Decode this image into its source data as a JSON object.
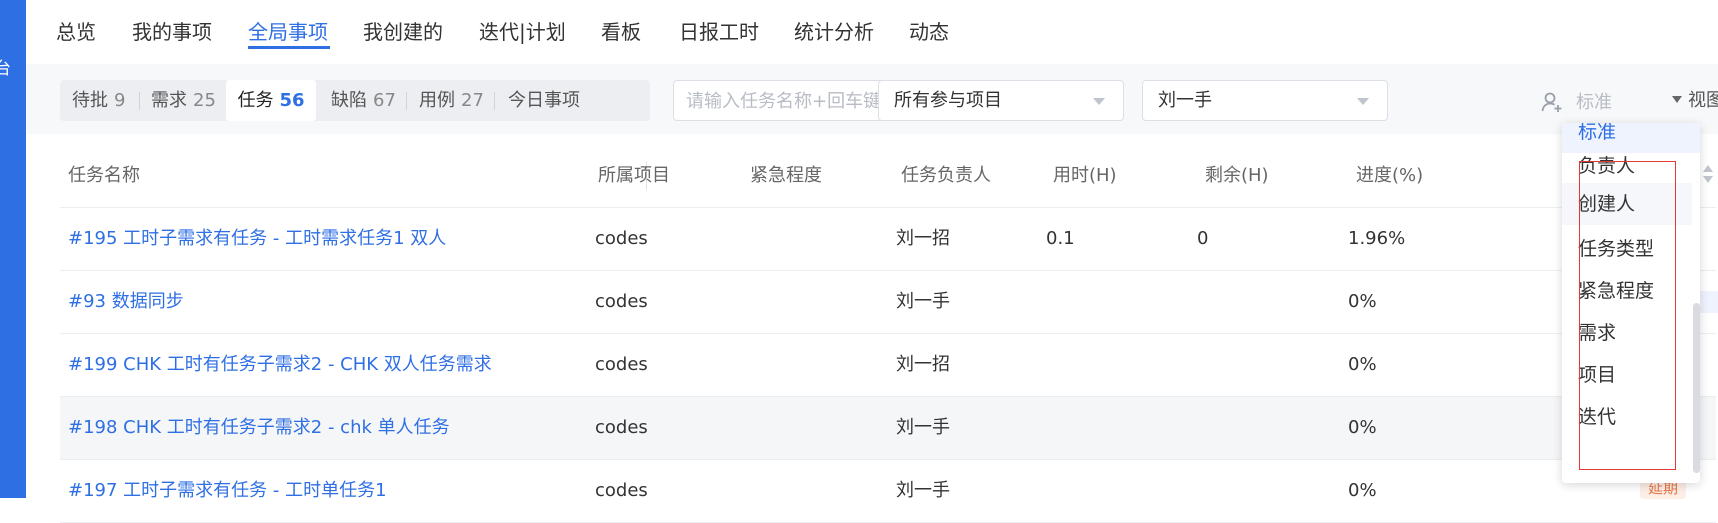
{
  "sidebar": {
    "fragment": "台"
  },
  "nav": {
    "tabs": [
      {
        "label": "总览"
      },
      {
        "label": "我的事项"
      },
      {
        "label": "全局事项"
      },
      {
        "label": "我创建的"
      },
      {
        "label": "迭代|计划"
      },
      {
        "label": "看板"
      },
      {
        "label": "日报工时"
      },
      {
        "label": "统计分析"
      },
      {
        "label": "动态"
      }
    ],
    "active": "全局事项"
  },
  "segments": [
    {
      "label": "待批",
      "count": "9"
    },
    {
      "label": "需求",
      "count": "25"
    },
    {
      "label": "任务",
      "count": "56"
    },
    {
      "label": "缺陷",
      "count": "67"
    },
    {
      "label": "用例",
      "count": "27"
    },
    {
      "label": "今日事项",
      "count": ""
    }
  ],
  "search": {
    "placeholder": "请输入任务名称+回车键",
    "value": ""
  },
  "project_select": {
    "value": "所有参与项目"
  },
  "person_select": {
    "value": "刘一手"
  },
  "assignee_toggle": {
    "label": "标准"
  },
  "view_menu": {
    "label": "视图"
  },
  "table": {
    "headers": [
      "任务名称",
      "所属项目",
      "紧急程度",
      "任务负责人",
      "用时(H)",
      "剩余(H)",
      "进度(%)"
    ],
    "rows": [
      {
        "name": "#195 工时子需求有任务 - 工时需求任务1 双人",
        "project": "codes",
        "urgency": "",
        "owner": "刘一招",
        "used": "0.1",
        "remain": "0",
        "progress": "1.96%"
      },
      {
        "name": "#93 数据同步",
        "project": "codes",
        "urgency": "",
        "owner": "刘一手",
        "used": "",
        "remain": "",
        "progress": "0%"
      },
      {
        "name": "#199 CHK 工时有任务子需求2 - CHK 双人任务需求",
        "project": "codes",
        "urgency": "",
        "owner": "刘一招",
        "used": "",
        "remain": "",
        "progress": "0%"
      },
      {
        "name": "#198 CHK 工时有任务子需求2 - chk 单人任务",
        "project": "codes",
        "urgency": "",
        "owner": "刘一手",
        "used": "",
        "remain": "",
        "progress": "0%"
      },
      {
        "name": "#197 工时子需求有任务 - 工时单任务1",
        "project": "codes",
        "urgency": "",
        "owner": "刘一手",
        "used": "",
        "remain": "",
        "progress": "0%"
      }
    ],
    "late_tag": "延期"
  },
  "dropdown": {
    "partial_top": "标准",
    "options": [
      "负责人",
      "创建人",
      "任务类型",
      "紧急程度",
      "需求",
      "项目",
      "迭代"
    ],
    "highlighted": "创建人"
  },
  "colors": {
    "accent": "#2f6fe4",
    "highlight_box": "#e53935"
  }
}
